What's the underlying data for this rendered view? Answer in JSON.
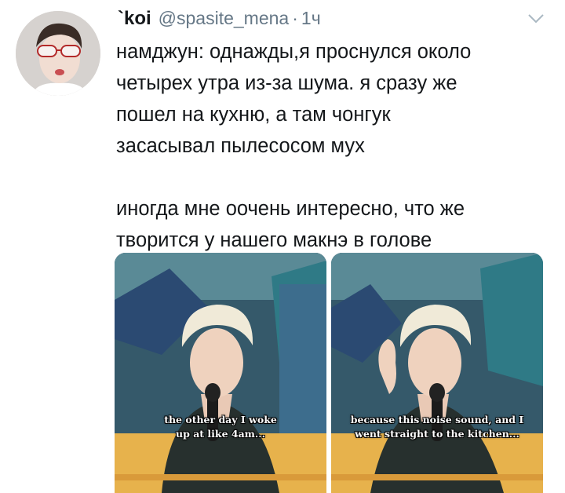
{
  "tweet": {
    "author_name": "`koi",
    "handle": "@spasite_mena",
    "separator": "·",
    "time": "1ч",
    "text_lines": [
      "намджун: однажды,я проснулся около",
      "четырех утра из-за шума. я сразу же",
      "пошел на кухню, а там чонгук",
      "засасывал пылесосом мух"
    ],
    "text_lines_2": [
      "иногда мне оочень интересно, что же",
      "творится у нашего макнэ в голове"
    ],
    "icons": {
      "avatar": "avatar",
      "more": "chevron-down-icon"
    }
  },
  "media": {
    "images": [
      {
        "caption_lines": [
          "the other day I woke",
          "up at like 4am..."
        ]
      },
      {
        "caption_lines": [
          "because this noise sound, and I",
          "went straight to the kitchen..."
        ]
      }
    ]
  }
}
